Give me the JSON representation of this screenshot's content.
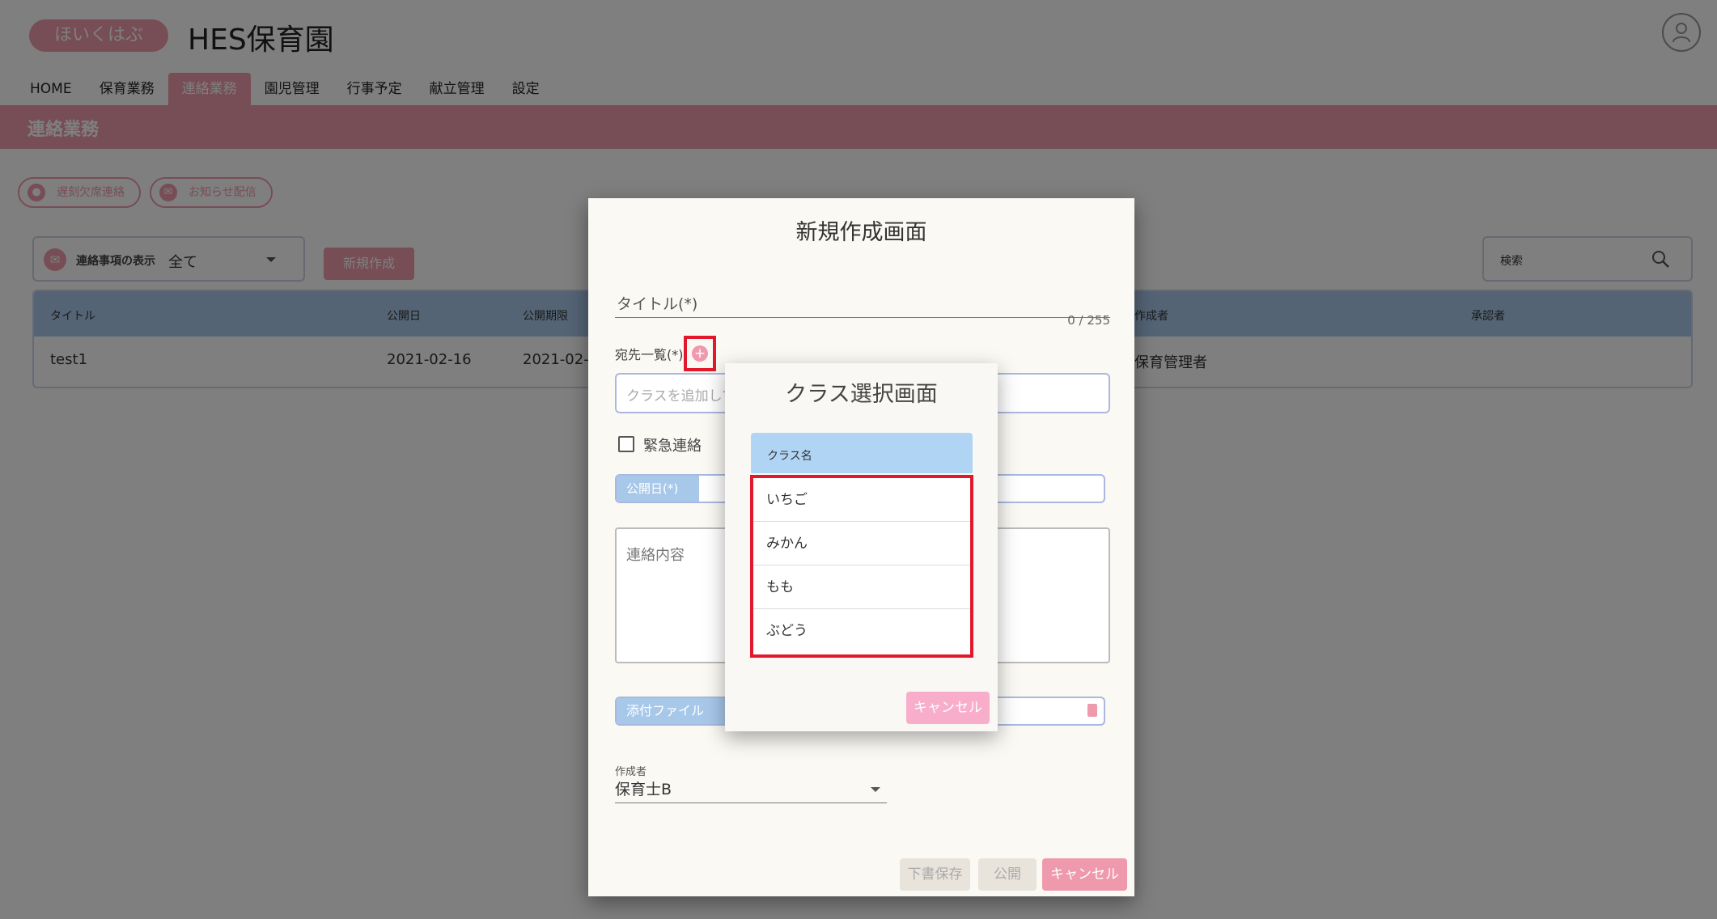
{
  "header": {
    "logo_text": "ほいくはぶ",
    "app_title": "HES保育園"
  },
  "nav": {
    "items": [
      "HOME",
      "保育業務",
      "連絡業務",
      "園児管理",
      "行事予定",
      "献立管理",
      "設定"
    ],
    "active_index": 2
  },
  "section": {
    "title": "連絡業務"
  },
  "actions": {
    "absence_label": "遅刻欠席連絡",
    "notice_label": "お知らせ配信",
    "new_label": "新規作成"
  },
  "filter": {
    "label": "連絡事項の表示",
    "value": "全て"
  },
  "search": {
    "label": "検索"
  },
  "table": {
    "headers": [
      "タイトル",
      "公開日",
      "公開期限",
      "作成者",
      "承認者"
    ],
    "rows": [
      {
        "title": "test1",
        "publish_date": "2021-02-16",
        "publish_deadline": "2021-02-",
        "author": "保育管理者",
        "approver": ""
      }
    ]
  },
  "dialog": {
    "title": "新規作成画面",
    "title_placeholder": "タイトル(*)",
    "counter": "0 / 255",
    "recipients_label": "宛先一覧(*)",
    "class_placeholder": "クラスを追加して",
    "urgent_label": "緊急連絡",
    "publish_date_label": "公開日(*)",
    "content_placeholder": "連絡内容",
    "attach_label": "添付ファイル",
    "author_label": "作成者",
    "author_value": "保育士B",
    "draft_label": "下書保存",
    "publish_label": "公開",
    "cancel_label": "キャンセル"
  },
  "modal": {
    "title": "クラス選択画面",
    "column_header": "クラス名",
    "classes": [
      "いちご",
      "みかん",
      "もも",
      "ぶどう"
    ],
    "cancel_label": "キャンセル"
  },
  "colors": {
    "brand_pink": "#ee9aac",
    "table_header_blue": "#a8c8ea",
    "highlight_red": "#e3182d"
  }
}
